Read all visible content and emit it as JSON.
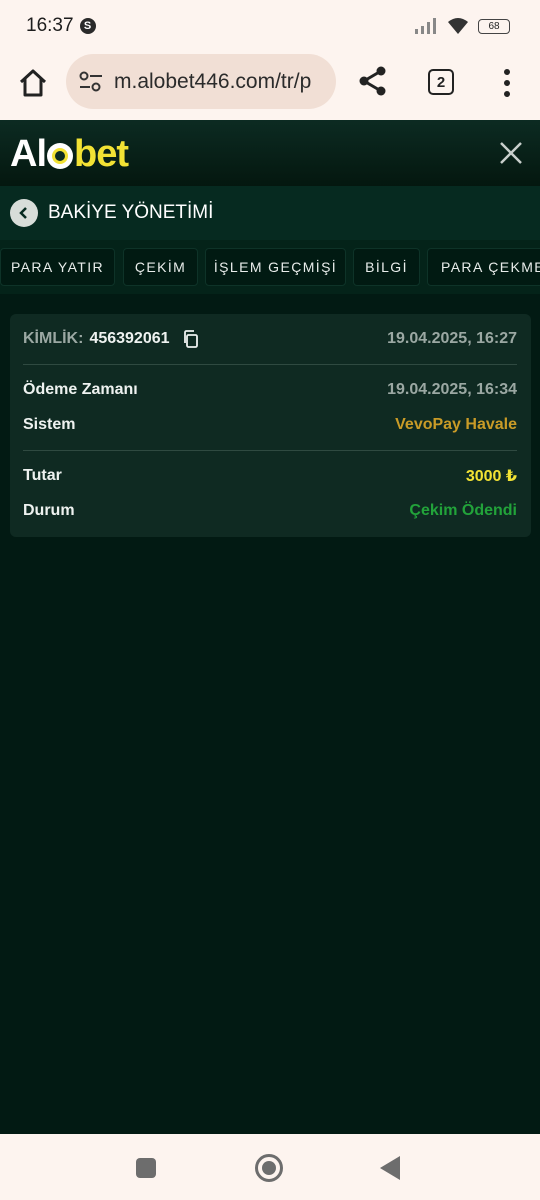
{
  "status_bar": {
    "time": "16:37",
    "battery": "68"
  },
  "browser": {
    "url": "m.alobet446.com/tr/p",
    "tab_count": "2"
  },
  "site": {
    "logo_part1": "Al",
    "logo_part2": "bet",
    "section_title": "BAKİYE YÖNETİMİ"
  },
  "tabs": [
    {
      "label": "PARA YATIR"
    },
    {
      "label": "ÇEKİM"
    },
    {
      "label": "İŞLEM GEÇMİŞİ"
    },
    {
      "label": "BİLGİ"
    },
    {
      "label": "PARA ÇEKME"
    }
  ],
  "transaction": {
    "id_label": "KİMLİK:",
    "id_value": "456392061",
    "created_at": "19.04.2025, 16:27",
    "payment_time_label": "Ödeme Zamanı",
    "payment_time_value": "19.04.2025, 16:34",
    "system_label": "Sistem",
    "system_value": "VevoPay Havale",
    "amount_label": "Tutar",
    "amount_value": "3000 ₺",
    "status_label": "Durum",
    "status_value": "Çekim Ödendi"
  },
  "colors": {
    "background": "#021a13",
    "accent_yellow": "#f2e234",
    "gold": "#c99b27",
    "success_green": "#22a33a"
  },
  "icons": {
    "status": "s-app-icon",
    "home": "home-icon",
    "tune": "tune-icon",
    "share": "share-icon",
    "menu": "more-vert-icon",
    "close": "close-icon",
    "back": "chevron-left-icon",
    "copy": "copy-icon"
  }
}
